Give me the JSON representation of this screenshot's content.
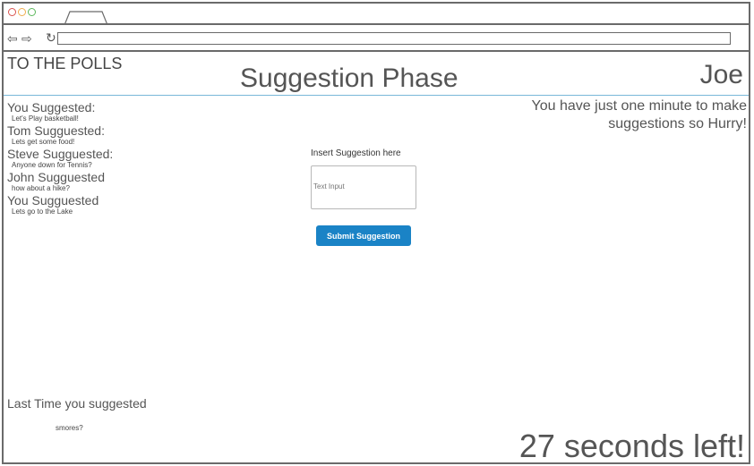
{
  "browser": {
    "dot_colors": [
      "#d9534f",
      "#f0ad4e",
      "#5cb85c"
    ],
    "back_icon": "⇦",
    "forward_icon": "⇨",
    "reload_icon": "↻"
  },
  "header": {
    "brand": "TO THE POLLS",
    "phase_title": "Suggestion Phase",
    "user_name": "Joe"
  },
  "history": [
    {
      "heading": "You Suggested:",
      "suggestion": "Let's Play basketball!"
    },
    {
      "heading": "Tom Sugguested:",
      "suggestion": "Lets get some food!"
    },
    {
      "heading": "Steve Sugguested:",
      "suggestion": "Anyone down for Tennis?"
    },
    {
      "heading": "John Sugguested",
      "suggestion": "how about a hike?"
    },
    {
      "heading": "You Sugguested",
      "suggestion": "Lets go to the Lake"
    }
  ],
  "notice": "You have just one minute to make suggestions  so Hurry!",
  "form": {
    "label": "Insert Suggestion here",
    "input_placeholder": "Text Input",
    "submit_label": "Submit Suggestion"
  },
  "last_suggestion": {
    "label": "Last Time you suggested",
    "value": "smores?"
  },
  "timer": "27 seconds left!",
  "colors": {
    "accent": "#1a83c6",
    "header_rule": "#79b7d8"
  }
}
